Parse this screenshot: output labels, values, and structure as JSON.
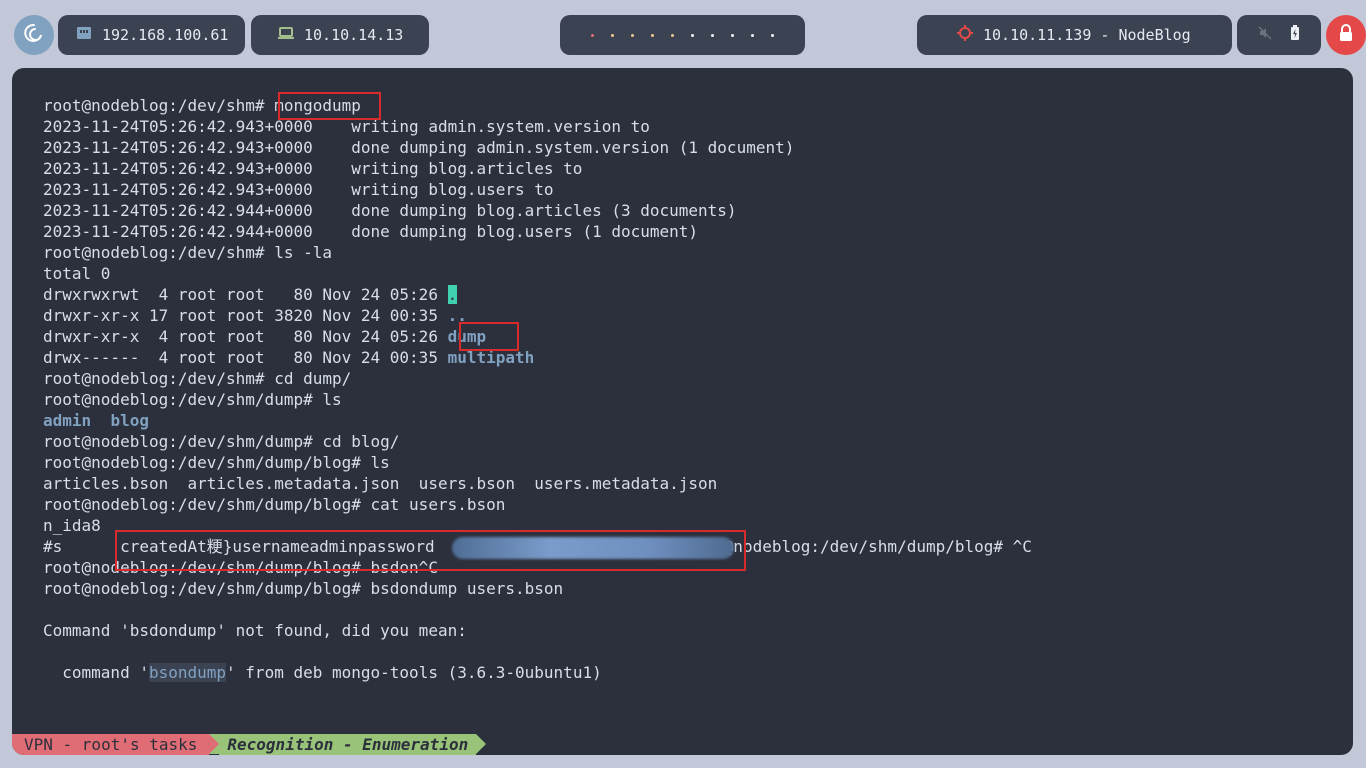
{
  "topbar": {
    "ip_local": "192.168.100.61",
    "ip_vpn": "10.10.14.13",
    "target": "10.10.11.139 - NodeBlog",
    "workspace_dots": [
      "#e06c75",
      "#ebcb8b",
      "#ebcb8b",
      "#ebcb8b",
      "#ebcb8b",
      "#eceff4",
      "#eceff4",
      "#eceff4",
      "#eceff4",
      "#eceff4"
    ]
  },
  "terminal": {
    "lines": [
      [
        {
          "t": "root@nodeblog:/dev/shm# "
        },
        {
          "t": "mongodump"
        }
      ],
      [
        {
          "t": "2023-11-24T05:26:42.943+0000    writing admin.system.version to"
        }
      ],
      [
        {
          "t": "2023-11-24T05:26:42.943+0000    done dumping admin.system.version (1 document)"
        }
      ],
      [
        {
          "t": "2023-11-24T05:26:42.943+0000    writing blog.articles to"
        }
      ],
      [
        {
          "t": "2023-11-24T05:26:42.943+0000    writing blog.users to"
        }
      ],
      [
        {
          "t": "2023-11-24T05:26:42.944+0000    done dumping blog.articles (3 documents)"
        }
      ],
      [
        {
          "t": "2023-11-24T05:26:42.944+0000    done dumping blog.users (1 document)"
        }
      ],
      [
        {
          "t": "root@nodeblog:/dev/shm# ls -la"
        }
      ],
      [
        {
          "t": "total 0"
        }
      ],
      [
        {
          "t": "drwxrwxrwt  4 root root   80 Nov 24 05:26 "
        },
        {
          "t": ".",
          "c": "cur"
        }
      ],
      [
        {
          "t": "drwxr-xr-x 17 root root 3820 Nov 24 00:35 "
        },
        {
          "t": "..",
          "c": "dir"
        }
      ],
      [
        {
          "t": "drwxr-xr-x  4 root root   80 Nov 24 05:26 "
        },
        {
          "t": "dump",
          "c": "dir"
        }
      ],
      [
        {
          "t": "drwx------  4 root root   80 Nov 24 00:35 "
        },
        {
          "t": "multipath",
          "c": "dir"
        }
      ],
      [
        {
          "t": "root@nodeblog:/dev/shm# cd dump/"
        }
      ],
      [
        {
          "t": "root@nodeblog:/dev/shm/dump# ls"
        }
      ],
      [
        {
          "t": "admin",
          "c": "dir"
        },
        {
          "t": "  "
        },
        {
          "t": "blog",
          "c": "dir"
        }
      ],
      [
        {
          "t": "root@nodeblog:/dev/shm/dump# cd blog/"
        }
      ],
      [
        {
          "t": "root@nodeblog:/dev/shm/dump/blog# ls"
        }
      ],
      [
        {
          "t": "articles.bson  articles.metadata.json  users.bson  users.metadata.json"
        }
      ],
      [
        {
          "t": "root@nodeblog:/dev/shm/dump/blog# cat users.bson"
        }
      ],
      [
        {
          "t": "n_ida8"
        }
      ],
      [
        {
          "t": "#s      createdAt粳}usernameadminpassword"
        },
        {
          "t": "                          "
        },
        {
          "t": "root@nodeblog:/dev/shm/dump/blog# ^C"
        }
      ],
      [
        {
          "t": "root@nodeblog:/dev/shm/dump/blog# bsdon^C"
        }
      ],
      [
        {
          "t": "root@nodeblog:/dev/shm/dump/blog# bsdondump users.bson"
        }
      ],
      [
        {
          "t": ""
        }
      ],
      [
        {
          "t": "Command 'bsdondump' not found, did you mean:"
        }
      ],
      [
        {
          "t": ""
        }
      ],
      [
        {
          "t": "  command '"
        },
        {
          "t": "bsondump",
          "c": "hl"
        },
        {
          "t": "' from deb mongo-tools (3.6.3-0ubuntu1)"
        }
      ]
    ]
  },
  "statusbar": {
    "session": "VPN - root's tasks",
    "window": "Recognition - Enumeration"
  }
}
